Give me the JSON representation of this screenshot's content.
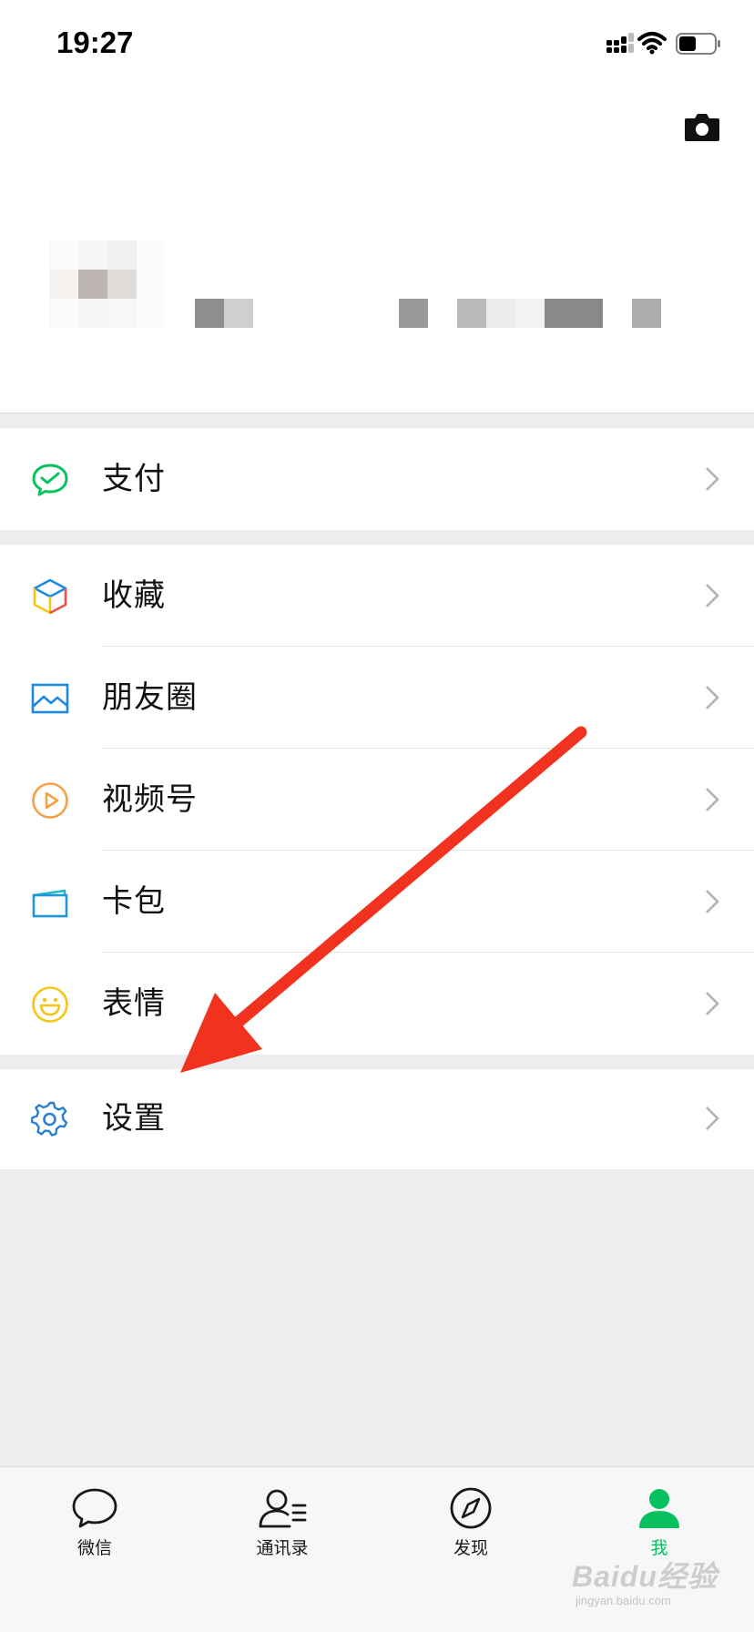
{
  "status_bar": {
    "time": "19:27"
  },
  "profile": {
    "name_blurred": true,
    "avatar_blurred": true
  },
  "menu_groups": [
    {
      "items": [
        {
          "label": "支付",
          "icon": "wechat-pay-icon",
          "color": "#07c160"
        }
      ]
    },
    {
      "items": [
        {
          "label": "收藏",
          "icon": "favorites-cube-icon",
          "color": "#f5a623"
        },
        {
          "label": "朋友圈",
          "icon": "moments-picture-icon",
          "color": "#1e88e5"
        },
        {
          "label": "视频号",
          "icon": "channels-play-icon",
          "color": "#f5a048"
        },
        {
          "label": "卡包",
          "icon": "card-wallet-icon",
          "color": "#1f96d9"
        },
        {
          "label": "表情",
          "icon": "sticker-smile-icon",
          "color": "#f5c518"
        }
      ]
    },
    {
      "items": [
        {
          "label": "设置",
          "icon": "settings-gear-icon",
          "color": "#2a7fd4"
        }
      ]
    }
  ],
  "tabbar": {
    "tabs": [
      {
        "label": "微信",
        "icon": "chat-bubble-icon",
        "active": false
      },
      {
        "label": "通讯录",
        "icon": "contacts-icon",
        "active": false
      },
      {
        "label": "发现",
        "icon": "discover-compass-icon",
        "active": false
      },
      {
        "label": "我",
        "icon": "me-person-icon",
        "active": true
      }
    ],
    "active_color": "#07c160"
  },
  "annotation": {
    "type": "red-arrow",
    "color": "#f1321e",
    "points_to": "设置"
  },
  "watermark": {
    "main": "Baidu经验",
    "sub": "jingyan.baidu.com"
  }
}
